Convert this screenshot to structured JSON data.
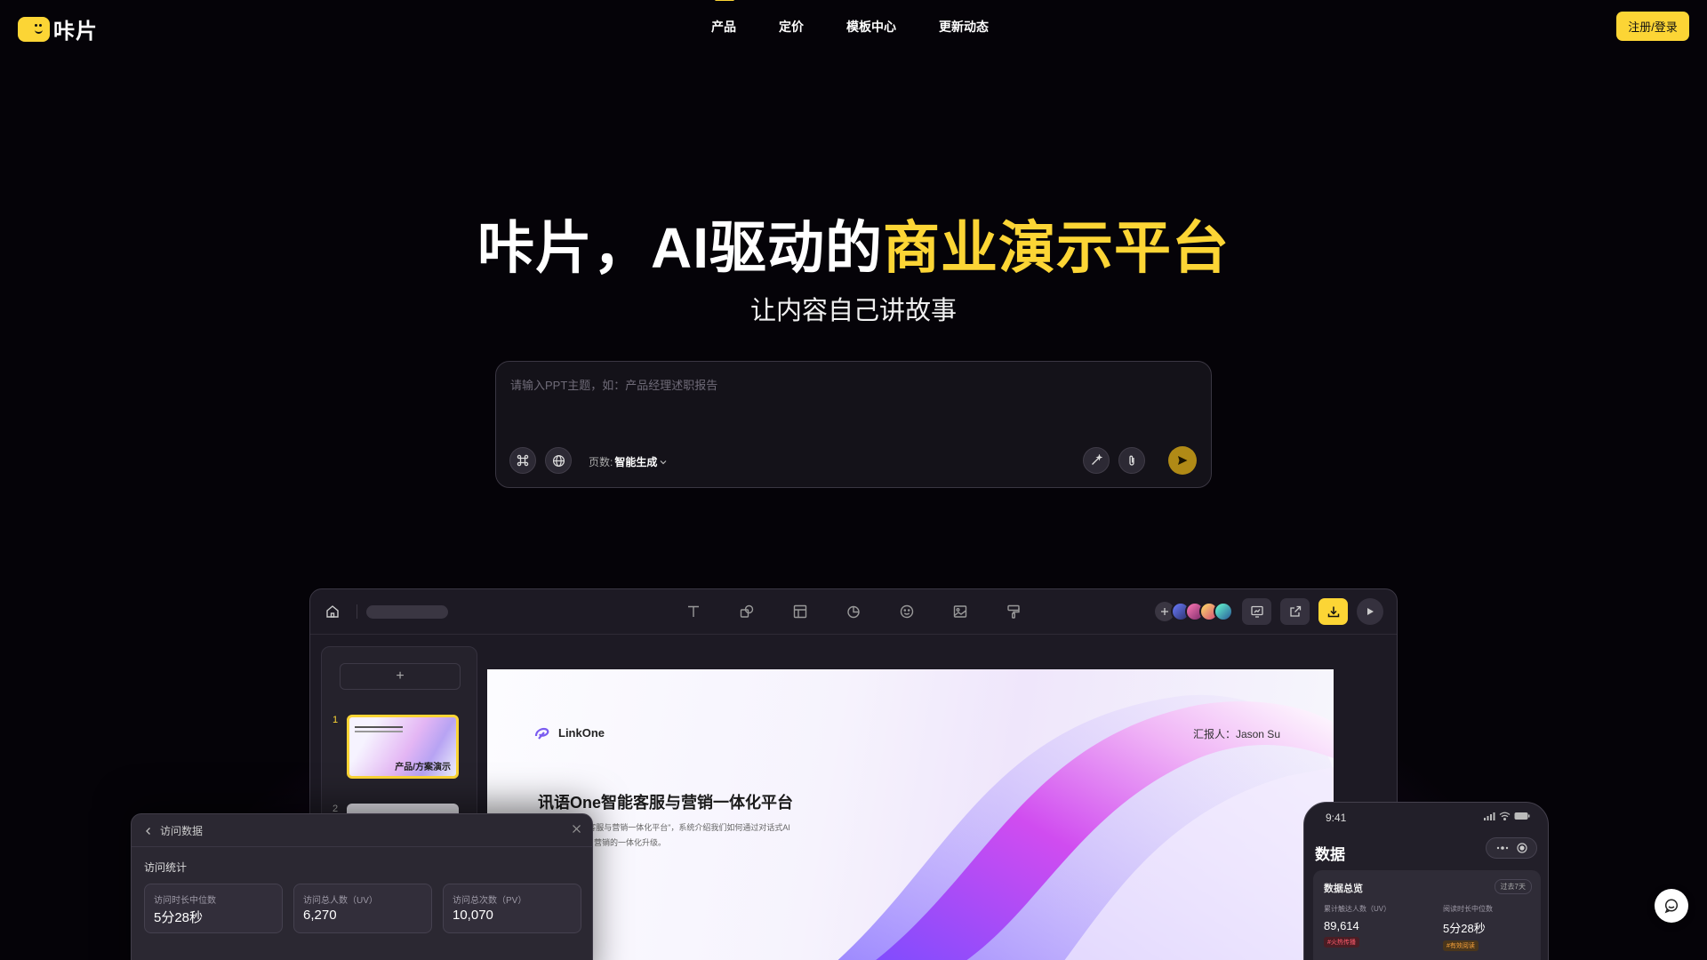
{
  "header": {
    "logo_text": "咔片",
    "nav": [
      {
        "label": "产品",
        "active": true
      },
      {
        "label": "定价"
      },
      {
        "label": "模板中心"
      },
      {
        "label": "更新动态"
      }
    ],
    "login_label": "注册/登录"
  },
  "hero": {
    "title_main": "咔片，AI驱动的",
    "title_highlight": "商业演示平台",
    "subtitle": "让内容自己讲故事"
  },
  "prompt": {
    "placeholder": "请输入PPT主题，如：产品经理述职报告",
    "pages_label": "页数:",
    "pages_value": "智能生成"
  },
  "editor": {
    "slides": [
      {
        "number": "1",
        "label": "产品/方案演示"
      },
      {
        "number": "2"
      }
    ],
    "add_label": "+",
    "canvas": {
      "brand": "LinkOne",
      "reporter": "汇报人：Jason Su",
      "title": "讯语One智能客服与营销一体化平台",
      "desc_line1": "\"讯语One智能客服与营销一体化平台\"，系统介绍我们如何通过对话式AI",
      "desc_line2": "实现企业客服与营销的一体化升级。"
    }
  },
  "visit_panel": {
    "title": "访问数据",
    "section": "访问统计",
    "stats": [
      {
        "label": "访问时长中位数",
        "value": "5分28秒"
      },
      {
        "label": "访问总人数（UV）",
        "value": "6,270"
      },
      {
        "label": "访问总次数（PV）",
        "value": "10,070"
      }
    ]
  },
  "phone_panel": {
    "time": "9:41",
    "title": "数据",
    "card_title": "数据总览",
    "range": "过去7天",
    "metrics": [
      {
        "label": "累计触达人数（UV）",
        "value": "89,614",
        "tag": "#火热传播"
      },
      {
        "label": "阅读时长中位数",
        "value": "5分28秒",
        "tag": "#有效阅读"
      }
    ]
  },
  "colors": {
    "accent": "#fcd535",
    "background": "#050308",
    "purple_glow": "#7828aa"
  }
}
